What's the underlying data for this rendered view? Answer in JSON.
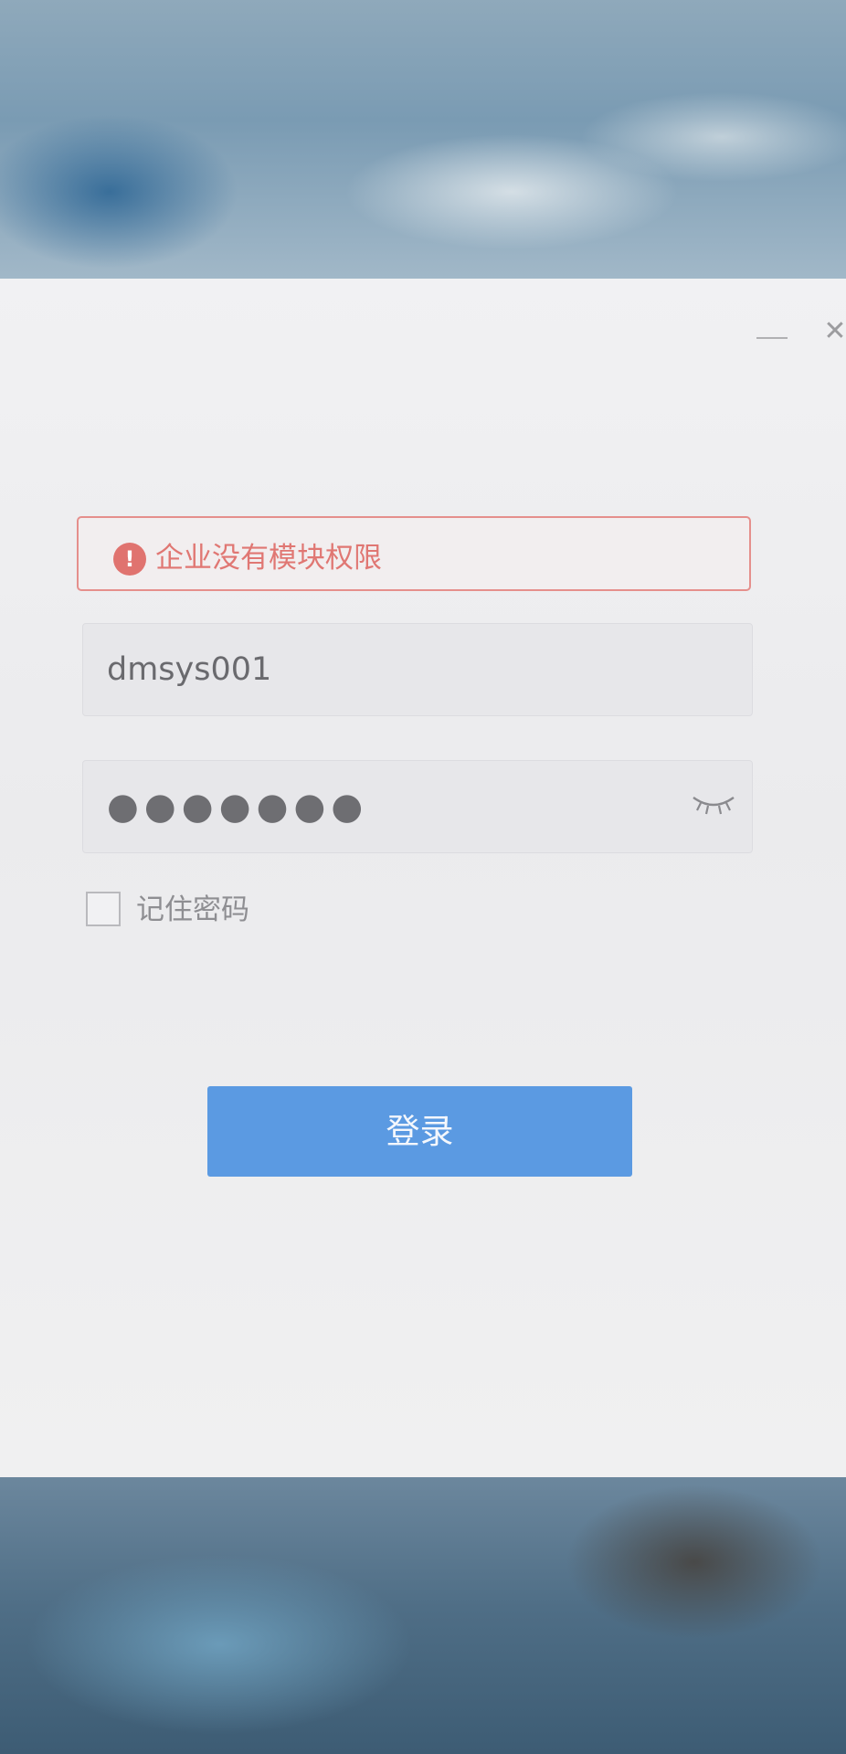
{
  "window_controls": {
    "minimize_icon": "minimize-icon",
    "close_icon": "close-icon",
    "close_glyph": "✕"
  },
  "error": {
    "icon": "error-icon",
    "icon_glyph": "!",
    "message": "企业没有模块权限",
    "border_color": "#e58f8c",
    "text_color": "#e07773"
  },
  "username": {
    "value": "dmsys001"
  },
  "password": {
    "value": "●●●●●●●",
    "toggle_icon": "eye-closed-icon"
  },
  "remember": {
    "label": "记住密码",
    "checked": false
  },
  "login_button": {
    "label": "登录",
    "color": "#5b9ae2"
  }
}
